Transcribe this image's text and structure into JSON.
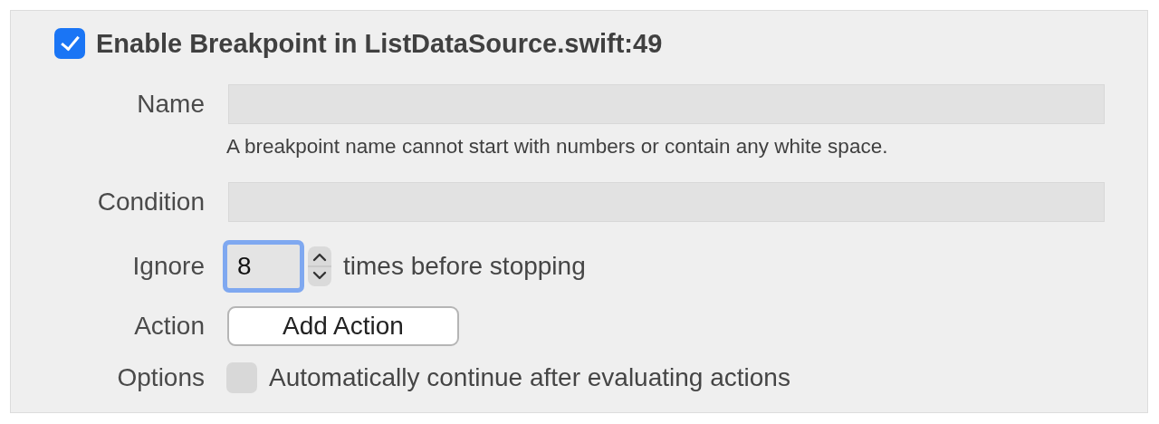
{
  "enable": {
    "label": "Enable Breakpoint in ListDataSource.swift:49",
    "checked": true
  },
  "name": {
    "label": "Name",
    "hint": "A breakpoint name cannot start with numbers or contain any white space."
  },
  "condition": {
    "label": "Condition"
  },
  "ignore": {
    "label": "Ignore",
    "value": "8",
    "suffix": "times before stopping",
    "focused": true
  },
  "action": {
    "label": "Action",
    "button": "Add Action"
  },
  "options": {
    "label": "Options",
    "checkbox_label": "Automatically continue after evaluating actions",
    "checked": false
  }
}
